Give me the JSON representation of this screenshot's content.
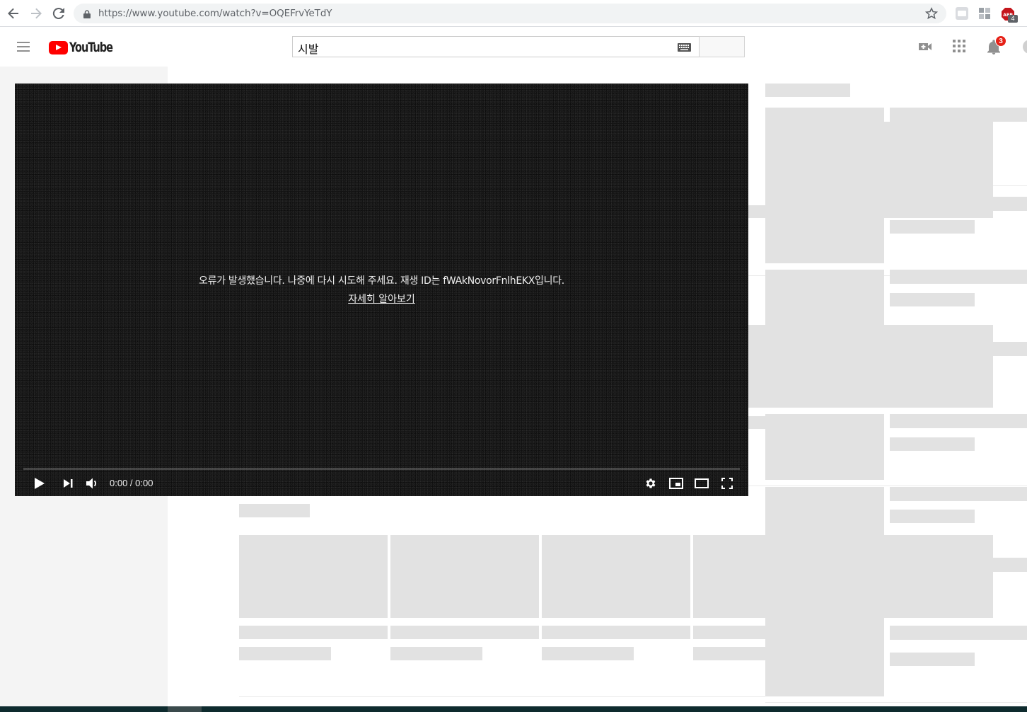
{
  "browser": {
    "url": "https://www.youtube.com/watch?v=OQEFrvYeTdY",
    "extension_badge": "4"
  },
  "masthead": {
    "logo_text": "YouTube",
    "search_value": "시발",
    "notification_count": "3"
  },
  "player": {
    "error_message": "오류가 발생했습니다. 나중에 다시 시도해 주세요. 재생 ID는 fWAkNovorFnlhEKX입니다.",
    "learn_more": "자세히 알아보기",
    "time_display": "0:00 / 0:00",
    "progress": 0
  },
  "colors": {
    "brand_red": "#ff0000",
    "badge_red": "#e62117",
    "placeholder_gray": "#e2e2e2",
    "player_bg": "#141414"
  }
}
